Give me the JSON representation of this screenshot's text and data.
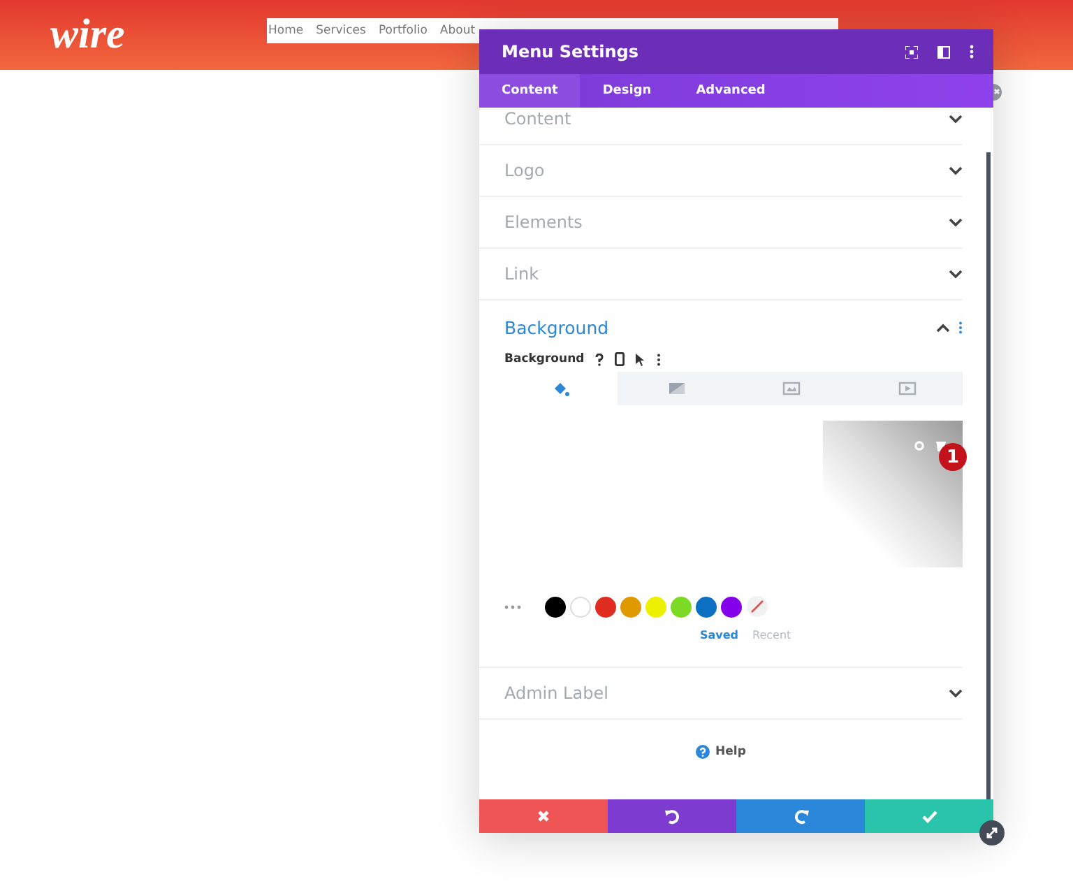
{
  "site": {
    "logo": "wire",
    "nav": [
      "Home",
      "Services",
      "Portfolio",
      "About"
    ]
  },
  "panel": {
    "title": "Menu Settings",
    "tabs": [
      {
        "label": "Content",
        "selected": true
      },
      {
        "label": "Design",
        "selected": false
      },
      {
        "label": "Advanced",
        "selected": false
      }
    ],
    "sections_before": [
      {
        "label": "Content",
        "expanded": false
      },
      {
        "label": "Logo",
        "expanded": false
      },
      {
        "label": "Elements",
        "expanded": false
      },
      {
        "label": "Link",
        "expanded": false
      }
    ],
    "background": {
      "label": "Background",
      "expanded": true,
      "field_label": "Background",
      "types": [
        {
          "kind": "color",
          "selected": true
        },
        {
          "kind": "gradient",
          "selected": false
        },
        {
          "kind": "image",
          "selected": false
        },
        {
          "kind": "video",
          "selected": false
        }
      ],
      "badge": "1",
      "swatches": [
        {
          "color": "#000000"
        },
        {
          "color": "#ffffff"
        },
        {
          "color": "#e02b20"
        },
        {
          "color": "#e09900"
        },
        {
          "color": "#edf000"
        },
        {
          "color": "#7cda24"
        },
        {
          "color": "#0c71c3"
        },
        {
          "color": "#8300e9"
        }
      ],
      "palette_tabs": [
        {
          "label": "Saved",
          "selected": true
        },
        {
          "label": "Recent",
          "selected": false
        }
      ]
    },
    "sections_after": [
      {
        "label": "Admin Label",
        "expanded": false
      }
    ],
    "help": "Help",
    "footer": [
      {
        "kind": "cancel"
      },
      {
        "kind": "undo"
      },
      {
        "kind": "redo"
      },
      {
        "kind": "save"
      }
    ]
  }
}
